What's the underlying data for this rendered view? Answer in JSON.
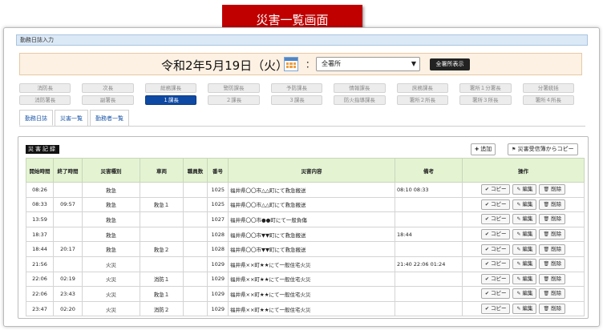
{
  "banner": {
    "title": "災害一覧画面"
  },
  "breadcrumb": "勤務日誌入力",
  "datebar": {
    "date": "令和2年5月19日（火）",
    "colon": "：",
    "station_select": "全署所",
    "show_all_button": "全署所表示"
  },
  "roles": {
    "row1": [
      "消防長",
      "次長",
      "総務課長",
      "警防課長",
      "予防課長",
      "情報課長",
      "庶務課長",
      "署所１分署長",
      "分署統括"
    ],
    "row2": [
      "消防署長",
      "副署長",
      "１課長",
      "２課長",
      "３課長",
      "防火指導課長",
      "署所２所長",
      "署所３所長",
      "署所４所長"
    ],
    "active": "１課長"
  },
  "tabs": [
    "勤務日誌",
    "災害一覧",
    "勤務者一覧"
  ],
  "panel": {
    "section_label": "災害記録",
    "add_button": "追加",
    "copy_from_button": "災害受信簿からコピー"
  },
  "table": {
    "headers": {
      "start": "開始時間",
      "end": "終了時間",
      "type": "災害種別",
      "vehicle": "車両",
      "staff": "職員数",
      "number": "番号",
      "content": "災害内容",
      "note": "備考",
      "ops": "操作"
    },
    "actions": {
      "copy": "コピー",
      "edit": "編集",
      "delete": "削除"
    },
    "rows": [
      {
        "start": "08:26",
        "end": "",
        "type": "救急",
        "vehicle": "",
        "staff": "",
        "number": "1025",
        "content": "福井県〇〇市△△町にて救急搬送",
        "note": "08:10 08:33"
      },
      {
        "start": "08:33",
        "end": "09:57",
        "type": "救急",
        "vehicle": "救急１",
        "staff": "",
        "number": "1025",
        "content": "福井県〇〇市△△町にて救急搬送",
        "note": ""
      },
      {
        "start": "13:59",
        "end": "",
        "type": "救急",
        "vehicle": "",
        "staff": "",
        "number": "1027",
        "content": "福井県〇〇市●●町にて一般負傷",
        "note": ""
      },
      {
        "start": "18:37",
        "end": "",
        "type": "救急",
        "vehicle": "",
        "staff": "",
        "number": "1028",
        "content": "福井県〇〇市▼▼町にて救急搬送",
        "note": "18:44"
      },
      {
        "start": "18:44",
        "end": "20:17",
        "type": "救急",
        "vehicle": "救急２",
        "staff": "",
        "number": "1028",
        "content": "福井県〇〇市▼▼町にて救急搬送",
        "note": ""
      },
      {
        "start": "21:56",
        "end": "",
        "type": "火災",
        "vehicle": "",
        "staff": "",
        "number": "1029",
        "content": "福井県××町★★にて一般住宅火災",
        "note": "21:40 22:06  01:24"
      },
      {
        "start": "22:06",
        "end": "02:19",
        "type": "火災",
        "vehicle": "消防１",
        "staff": "",
        "number": "1029",
        "content": "福井県××町★★にて一般住宅火災",
        "note": ""
      },
      {
        "start": "22:06",
        "end": "23:43",
        "type": "火災",
        "vehicle": "救急１",
        "staff": "",
        "number": "1029",
        "content": "福井県××町★★にて一般住宅火災",
        "note": ""
      },
      {
        "start": "23:47",
        "end": "02:20",
        "type": "火災",
        "vehicle": "消防２",
        "staff": "",
        "number": "1029",
        "content": "福井県××町★★にて一般住宅火災",
        "note": ""
      }
    ]
  }
}
